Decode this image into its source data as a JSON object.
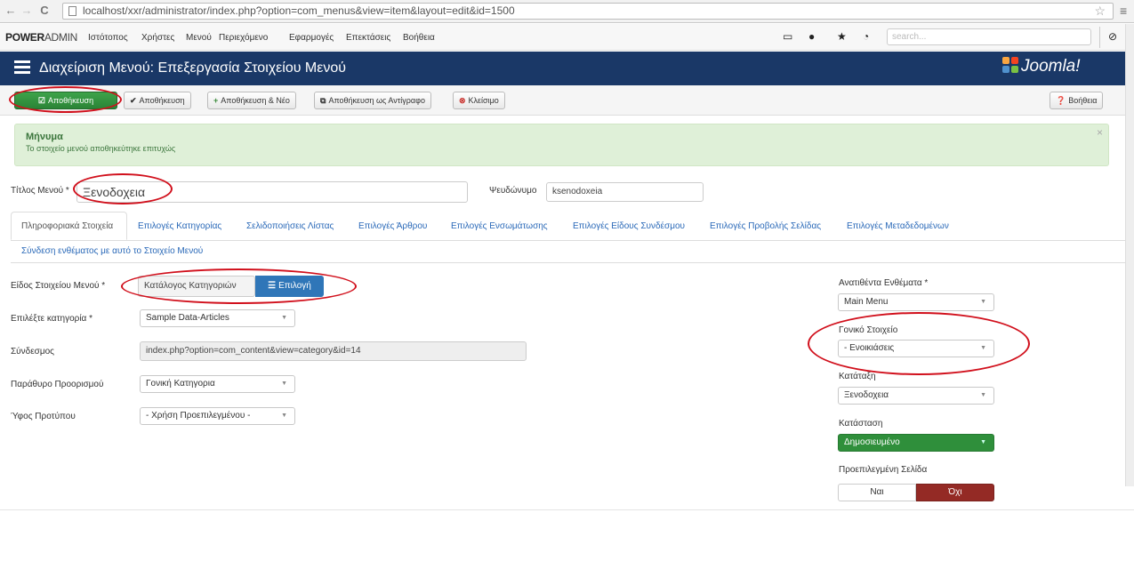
{
  "browser": {
    "url": "localhost/xxr/administrator/index.php?option=com_menus&view=item&layout=edit&id=1500"
  },
  "topnav": {
    "brand_bold": "POWER",
    "brand_rest": "ADMIN",
    "items": [
      "Ιστότοπος",
      "Χρήστες",
      "Μενού",
      "Περιεχόμενο",
      "Εφαρμογές",
      "Επεκτάσεις",
      "Βοήθεια"
    ],
    "search_placeholder": "search..."
  },
  "header": {
    "title": "Διαχείριση Μενού: Επεξεργασία Στοιχείου Μενού",
    "logo_text": "Joomla!"
  },
  "toolbar": {
    "save": "Αποθήκευση",
    "save_close": "Αποθήκευση",
    "save_new": "Αποθήκευση & Νέο",
    "save_copy": "Αποθήκευση ως Αντίγραφο",
    "close": "Κλείσιμο",
    "help": "Βοήθεια"
  },
  "message": {
    "title": "Μήνυμα",
    "text": "Το στοιχείο μενού αποθηκεύτηκε επιτυχώς"
  },
  "form": {
    "title_label": "Τίτλος Μενού *",
    "title_value": "Ξενοδοχεια",
    "alias_label": "Ψευδώνυμο",
    "alias_value": "ksenodoxeia"
  },
  "tabs": [
    "Πληροφοριακά Στοιχεία",
    "Επιλογές Κατηγορίας",
    "Σελιδοποιήσεις Λίστας",
    "Επιλογές Άρθρου",
    "Επιλογές Ενσωμάτωσης",
    "Επιλογές Είδους Συνδέσμου",
    "Επιλογές Προβολής Σελίδας",
    "Επιλογές Μεταδεδομένων",
    "Σύνδεση ενθέματος με αυτό το Στοιχείο Μενού"
  ],
  "details": {
    "type_label": "Είδος Στοιχείου Μενού *",
    "type_value": "Κατάλογος Κατηγοριών",
    "type_button": "Επιλογή",
    "category_label": "Επιλέξτε κατηγορία *",
    "category_value": "Sample Data-Articles",
    "link_label": "Σύνδεσμος",
    "link_value": "index.php?option=com_content&view=category&id=14",
    "target_label": "Παράθυρο Προορισμού",
    "target_value": "Γονική Κατηγορια",
    "template_label": "Ύφος Προτύπου",
    "template_value": "- Χρήση Προεπιλεγμένου -"
  },
  "sidebar": {
    "menu_label": "Ανατιθέντα Ενθέματα *",
    "menu_value": "Main Menu",
    "parent_label": "Γονικό Στοιχείο",
    "parent_value": "- Ενοικιάσεις",
    "order_label": "Κατάταξη",
    "order_value": "Ξενοδοχεια",
    "status_label": "Κατάσταση",
    "status_value": "Δημοσιευμένο",
    "default_label": "Προεπιλεγμένη Σελίδα",
    "default_yes": "Ναι",
    "default_no": "Όχι"
  },
  "colors": {
    "header_bg": "#1a3867",
    "save_green": "#2f8f3b",
    "annotation_red": "#d1101c",
    "no_active": "#942a25"
  }
}
